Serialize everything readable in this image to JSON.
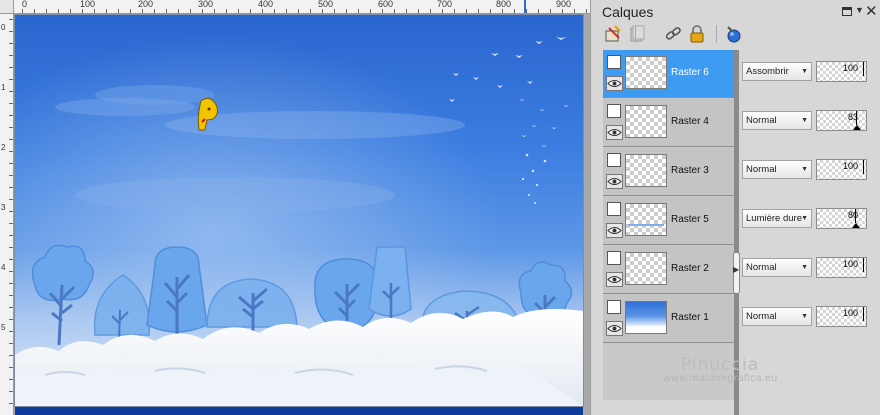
{
  "ruler": {
    "top_labels": [
      "0",
      "100",
      "200",
      "300",
      "400",
      "500",
      "600",
      "700",
      "800",
      "900"
    ],
    "left_labels": [
      "0",
      "1",
      "2",
      "3",
      "4",
      "5"
    ]
  },
  "layers_panel": {
    "title": "Calques",
    "toolbar_icons": [
      "new-raster-layer-icon",
      "new-mask-layer-icon",
      "link-icon",
      "lock-icon",
      "blend-ranges-icon"
    ],
    "layers": [
      {
        "name": "Raster 6",
        "selected": true,
        "thumbnail": "transparent",
        "blend_mode": "Assombrir",
        "opacity": "100"
      },
      {
        "name": "Raster 4",
        "selected": false,
        "thumbnail": "transparent",
        "blend_mode": "Normal",
        "opacity": "83"
      },
      {
        "name": "Raster 3",
        "selected": false,
        "thumbnail": "transparent",
        "blend_mode": "Normal",
        "opacity": "100"
      },
      {
        "name": "Raster 5",
        "selected": false,
        "thumbnail": "transparent",
        "blend_mode": "Lumière dure",
        "opacity": "80"
      },
      {
        "name": "Raster 2",
        "selected": false,
        "thumbnail": "transparent",
        "blend_mode": "Normal",
        "opacity": "100"
      },
      {
        "name": "Raster 1",
        "selected": false,
        "thumbnail": "sky",
        "blend_mode": "Normal",
        "opacity": "100"
      }
    ]
  },
  "watermark": {
    "name": "Pinuccia",
    "site": "www.maidiregrafica.eu"
  },
  "colors": {
    "selection": "#3d9bf2",
    "sky_top": "#2a6ad3",
    "sky_bottom": "#8fb7ee",
    "trees": "#5b9ee8"
  }
}
